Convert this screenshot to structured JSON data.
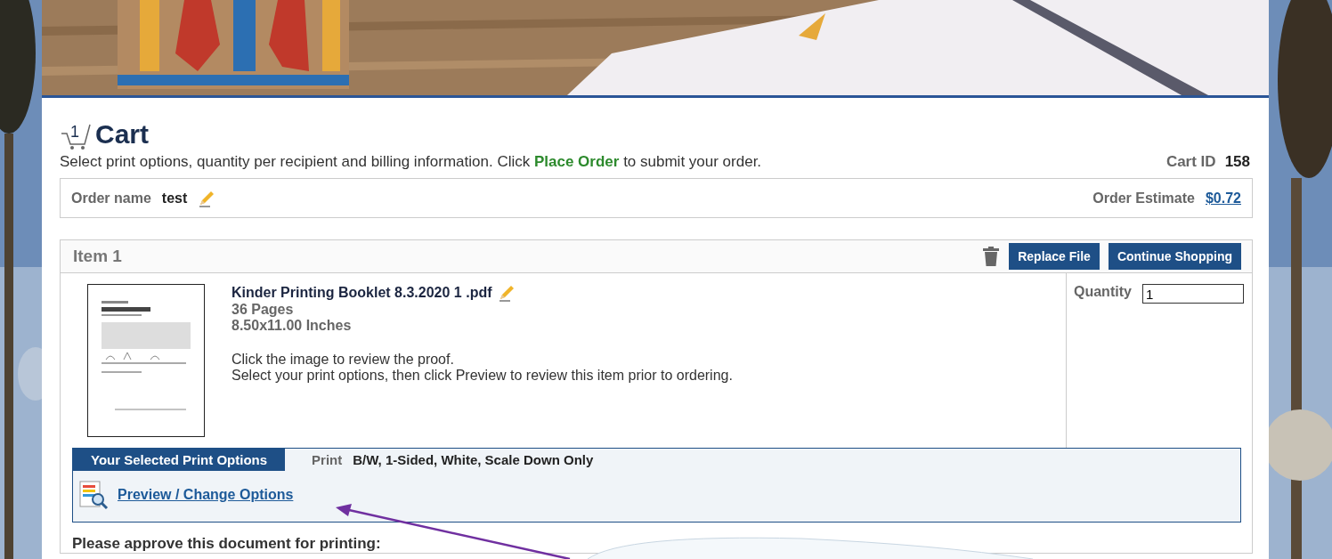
{
  "cart": {
    "count": "1",
    "title": "Cart",
    "intro": "Select print options, quantity per recipient and billing information. Click **Place Order** to submit your order.",
    "id_label": "Cart ID",
    "id_value": "158"
  },
  "order": {
    "name_label": "Order name",
    "name_value": "test",
    "estimate_label": "Order Estimate",
    "estimate_value": "$0.72"
  },
  "item": {
    "title": "Item 1",
    "buttons": [
      "Replace File",
      "Continue Shopping"
    ],
    "file_name": "Kinder Printing Booklet 8.3.2020 1 .pdf",
    "details": [
      "36 Pages",
      "8.50x11.00 Inches"
    ],
    "notes": [
      "Click the image to review the proof.",
      "Select your print options, then click Preview to review this item prior to ordering."
    ],
    "quantity": {
      "label": "Quantity",
      "value": "1"
    },
    "options": {
      "tab": "Your Selected Print Options",
      "label": "Print",
      "value": "B/W, 1-Sided, White, Scale Down Only",
      "link": "Preview / Change Options"
    }
  },
  "approve": "Please approve this document for printing:"
}
